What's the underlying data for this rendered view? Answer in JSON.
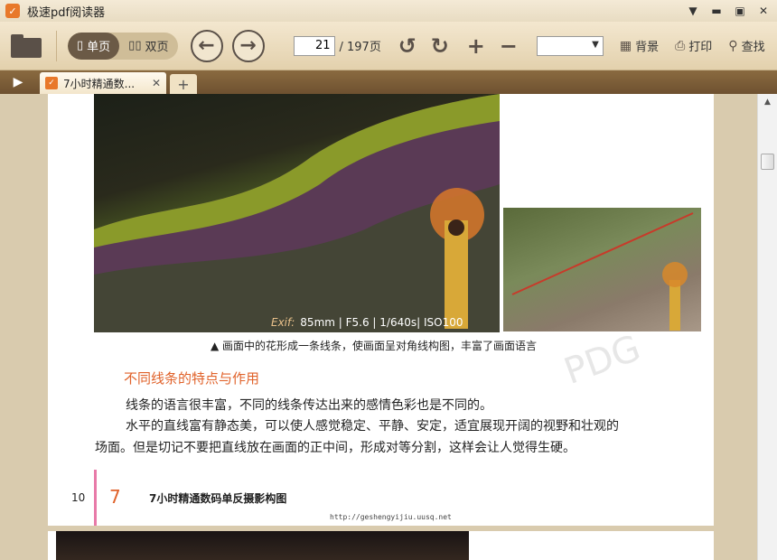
{
  "app": {
    "title": "极速pdf阅读器"
  },
  "toolbar": {
    "single_page_label": "单页",
    "double_page_label": "双页",
    "current_page": "21",
    "total_pages": "/ 197页",
    "background_label": "背景",
    "print_label": "打印",
    "find_label": "查找"
  },
  "tab": {
    "title": "7小时精通数..."
  },
  "document": {
    "exif_brand": "Exif:",
    "exif_text": "85mm | F5.6  | 1/640s| ISO100",
    "caption": "▲ 画面中的花形成一条线条，使画面呈对角线构图，丰富了画面语言",
    "heading": "不同线条的特点与作用",
    "paragraph1": "线条的语言很丰富，不同的线条传达出来的感情色彩也是不同的。",
    "paragraph2_line1": "水平的直线富有静态美，可以使人感觉稳定、平静、安定，适宜展现开阔的视野和壮观的",
    "paragraph2_line2": "场面。但是切记不要把直线放在画面的正中间，形成对等分割，这样会让人觉得生硬。",
    "page_number": "10",
    "chapter_number": "7",
    "chapter_title": "7小时精通数码单反摄影构图",
    "url": "http://geshengyijiu.uusq.net",
    "watermark": "PDG"
  }
}
